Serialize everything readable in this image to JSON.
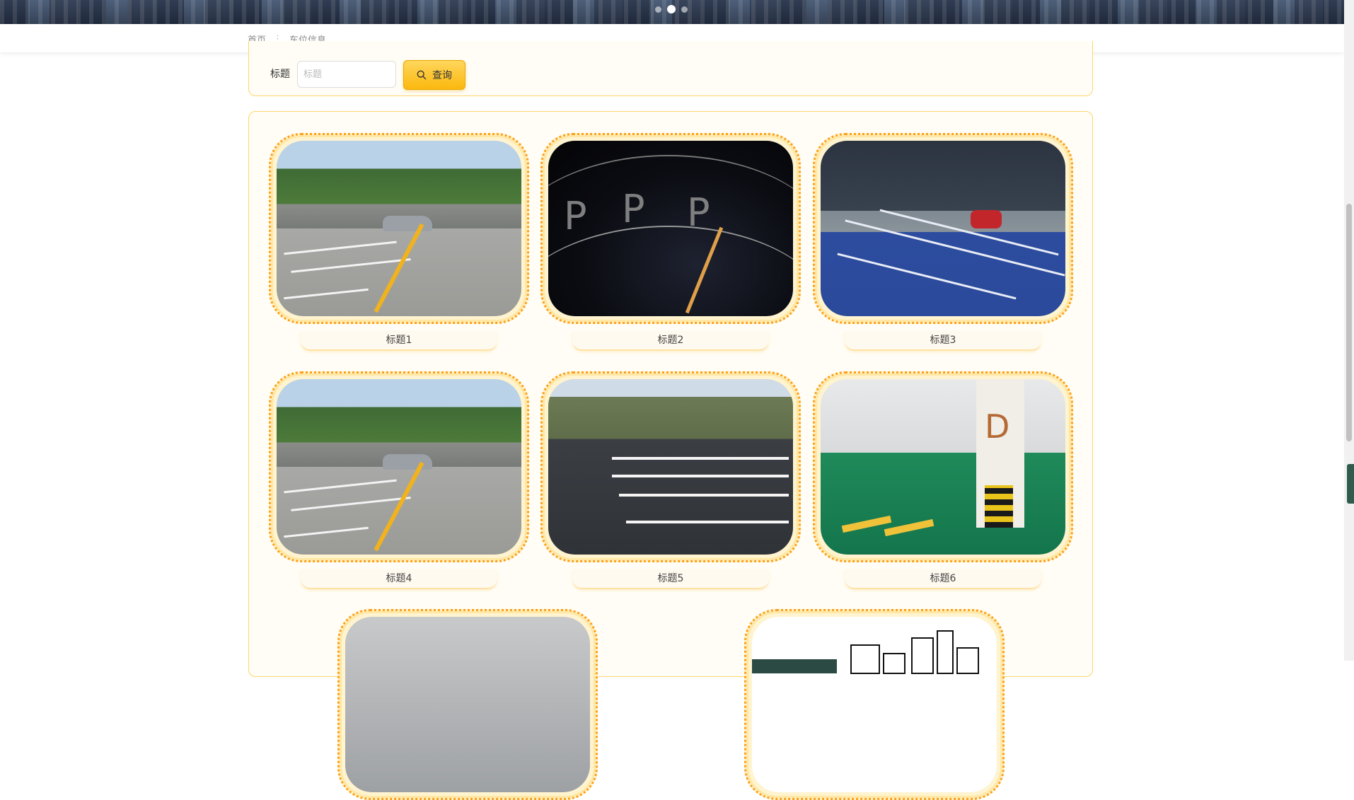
{
  "banner": {
    "carousel_dots": 3,
    "active_dot": 2
  },
  "breadcrumb": {
    "home": "首页",
    "separator": "⋮",
    "current": "车位信息"
  },
  "search": {
    "label": "标题",
    "placeholder": "标题",
    "value": "",
    "button_label": "查询",
    "button_icon": "search-icon",
    "accent": "#fbb80e"
  },
  "items": [
    {
      "title": "标题1",
      "image": "outdoor-parking-lot"
    },
    {
      "title": "标题2",
      "image": "dark-parking-graphic"
    },
    {
      "title": "标题3",
      "image": "blue-parking-space"
    },
    {
      "title": "标题4",
      "image": "outdoor-parking-lot"
    },
    {
      "title": "标题5",
      "image": "asphalt-parking-lot"
    },
    {
      "title": "标题6",
      "image": "underground-garage"
    },
    {
      "title": "",
      "image": "parking-entrance"
    },
    {
      "title": "",
      "image": "city-illustration"
    }
  ],
  "theme": {
    "border": "#ffd56b",
    "frame": "#ff9f1a",
    "panel_bg": "#fffdf5"
  }
}
